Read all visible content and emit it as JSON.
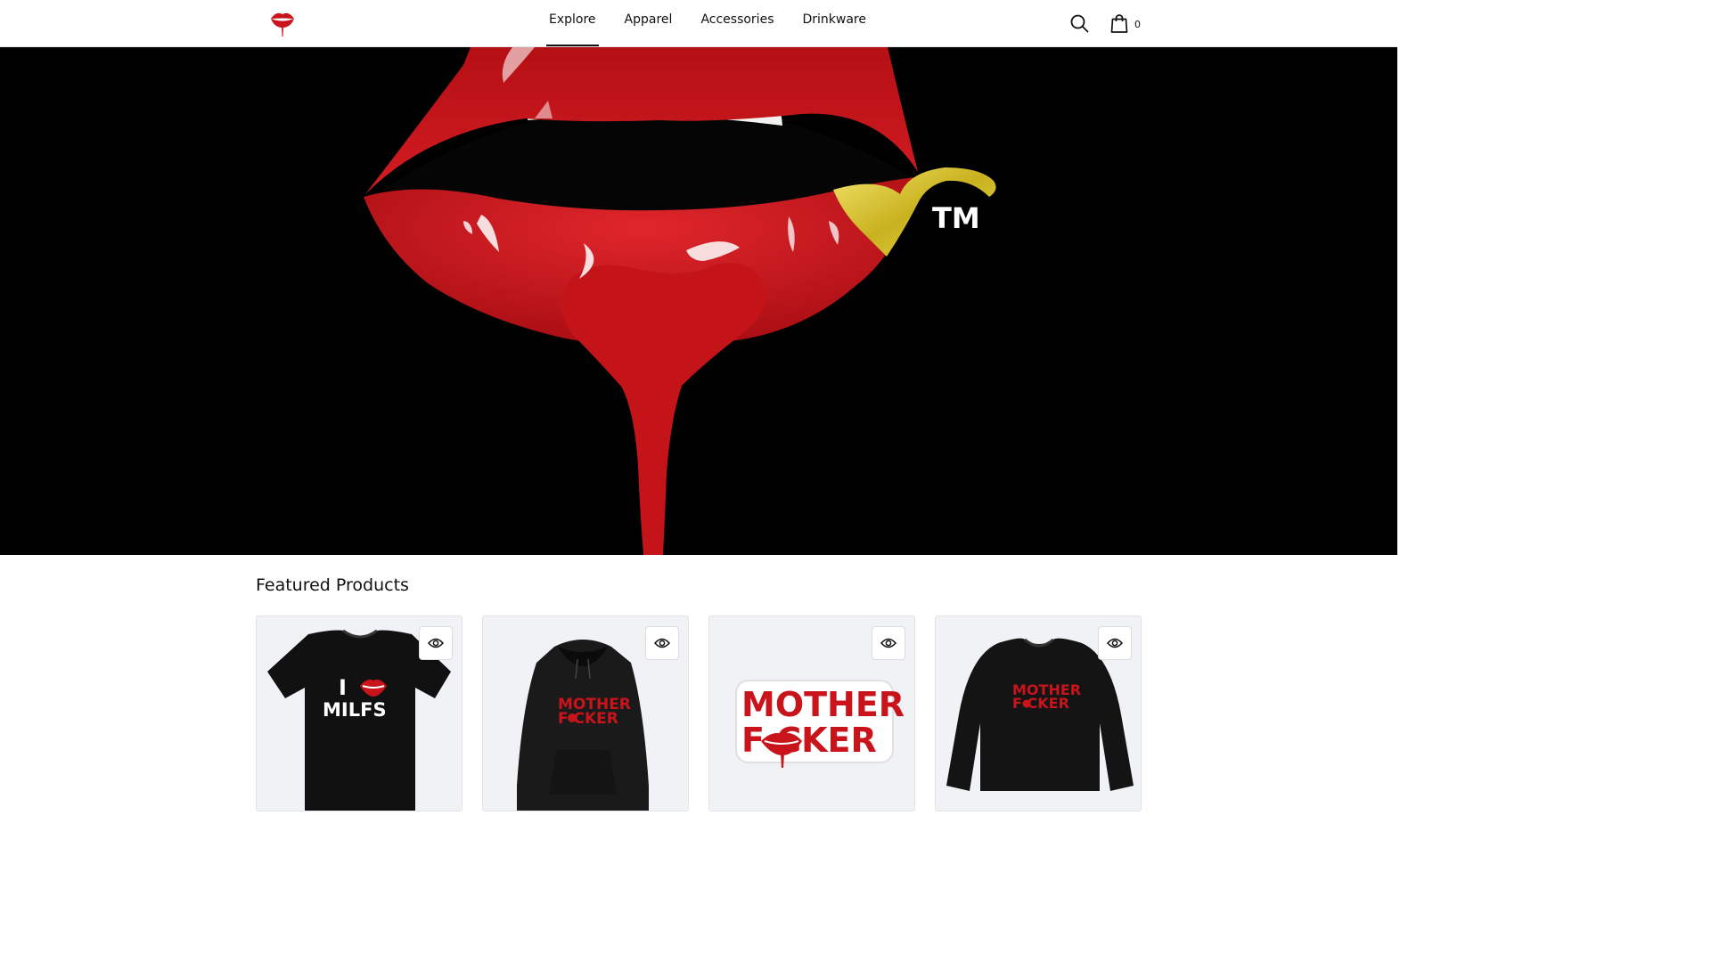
{
  "header": {
    "logo": "lips-logo",
    "nav": [
      {
        "label": "Explore",
        "active": true
      },
      {
        "label": "Apparel",
        "active": false
      },
      {
        "label": "Accessories",
        "active": false
      },
      {
        "label": "Drinkware",
        "active": false
      }
    ],
    "search_icon": "search-icon",
    "cart_icon": "shopping-bag-icon",
    "cart_count": "0"
  },
  "hero": {
    "image": "dripping-red-lips",
    "trademark": "TM",
    "colors": {
      "background": "#000000",
      "lips": "#c8141a",
      "tongue_stud": "#d4c22e"
    }
  },
  "featured": {
    "title": "Featured Products",
    "quick_view_icon": "eye-icon",
    "products": [
      {
        "image": "black-tshirt",
        "print_line1": "I",
        "print_line2": "MILFS"
      },
      {
        "image": "black-hoodie",
        "print_line1": "MOTHER",
        "print_line2": "F CKER"
      },
      {
        "image": "sticker",
        "print_line1": "MOTHER",
        "print_line2": "F CKER"
      },
      {
        "image": "black-sweatshirt",
        "print_line1": "MOTHER",
        "print_line2": "F CKER"
      }
    ]
  }
}
